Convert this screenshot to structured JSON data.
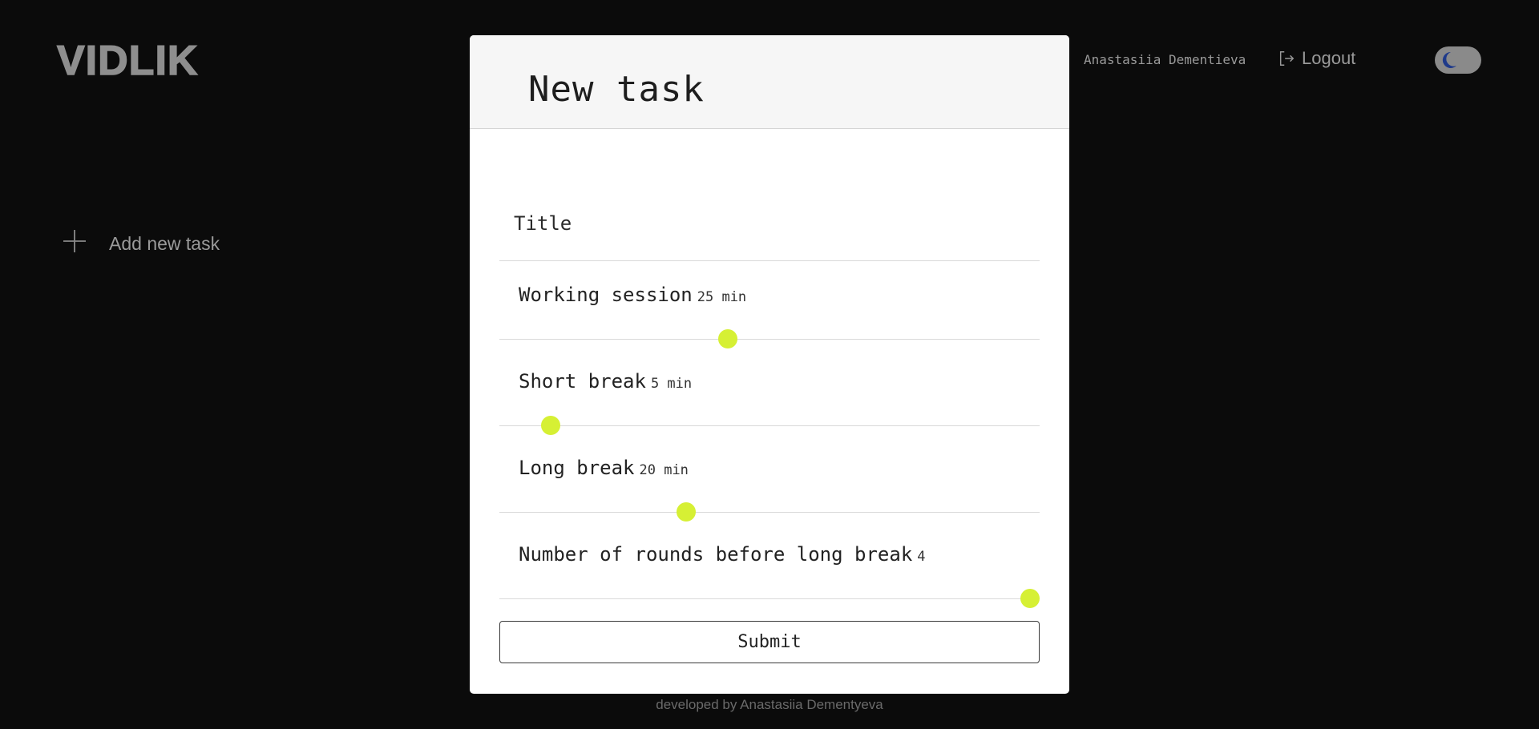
{
  "header": {
    "logo": "VIDLIK",
    "user_name": "Anastasiia Dementieva",
    "logout_label": "Logout",
    "theme_toggle": {
      "mode": "dark",
      "icon": "moon-icon",
      "icon_color": "#1f3a8a"
    }
  },
  "sidebar": {
    "add_task_label": "Add new task"
  },
  "footer": {
    "credit": "developed by Anastasiia Dementyeva"
  },
  "modal": {
    "title": "New task",
    "title_field": {
      "placeholder": "Title",
      "value": ""
    },
    "sliders": [
      {
        "label": "Working session",
        "value_text": "25 min",
        "value": 25,
        "position_fraction": 0.42
      },
      {
        "label": "Short break",
        "value_text": "5 min",
        "value": 5,
        "position_fraction": 0.08
      },
      {
        "label": "Long break",
        "value_text": "20 min",
        "value": 20,
        "position_fraction": 0.34
      },
      {
        "label": "Number of rounds before long break",
        "value_text": "4",
        "value": 4,
        "position_fraction": 1.0
      }
    ],
    "submit_label": "Submit"
  },
  "colors": {
    "background": "#0b0b0b",
    "accent": "#d6f034",
    "modal_bg": "#ffffff",
    "muted_text": "#9a9a9a"
  }
}
